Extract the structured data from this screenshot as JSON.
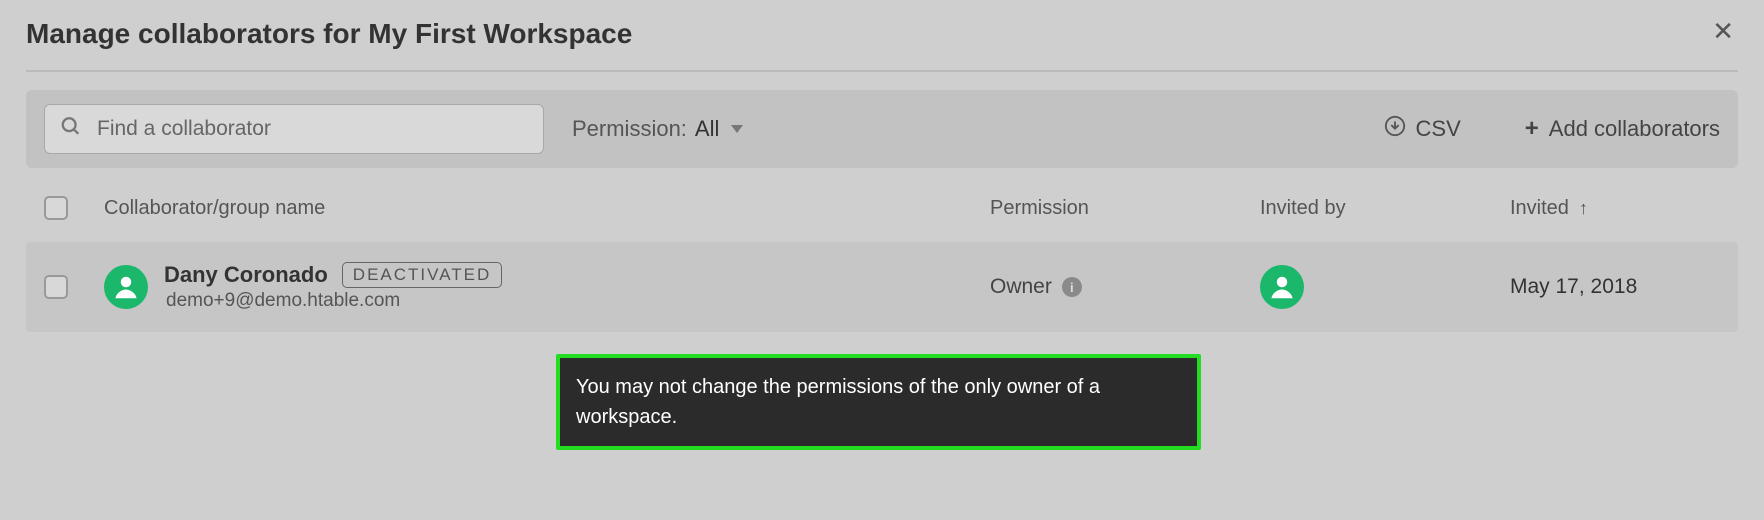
{
  "modal": {
    "title": "Manage collaborators for My First Workspace"
  },
  "toolbar": {
    "search_placeholder": "Find a collaborator",
    "permission_label": "Permission:",
    "permission_value": "All",
    "csv_label": "CSV",
    "add_label": "Add collaborators"
  },
  "table": {
    "columns": {
      "name": "Collaborator/group name",
      "permission": "Permission",
      "invited_by": "Invited by",
      "invited": "Invited"
    },
    "sort_column": "invited",
    "sort_dir": "asc"
  },
  "rows": [
    {
      "name": "Dany Coronado",
      "badge": "DEACTIVATED",
      "email": "demo+9@demo.htable.com",
      "permission": "Owner",
      "invited": "May 17, 2018"
    }
  ],
  "tooltip": {
    "text": "You may not change the permissions of the only owner of a workspace."
  }
}
